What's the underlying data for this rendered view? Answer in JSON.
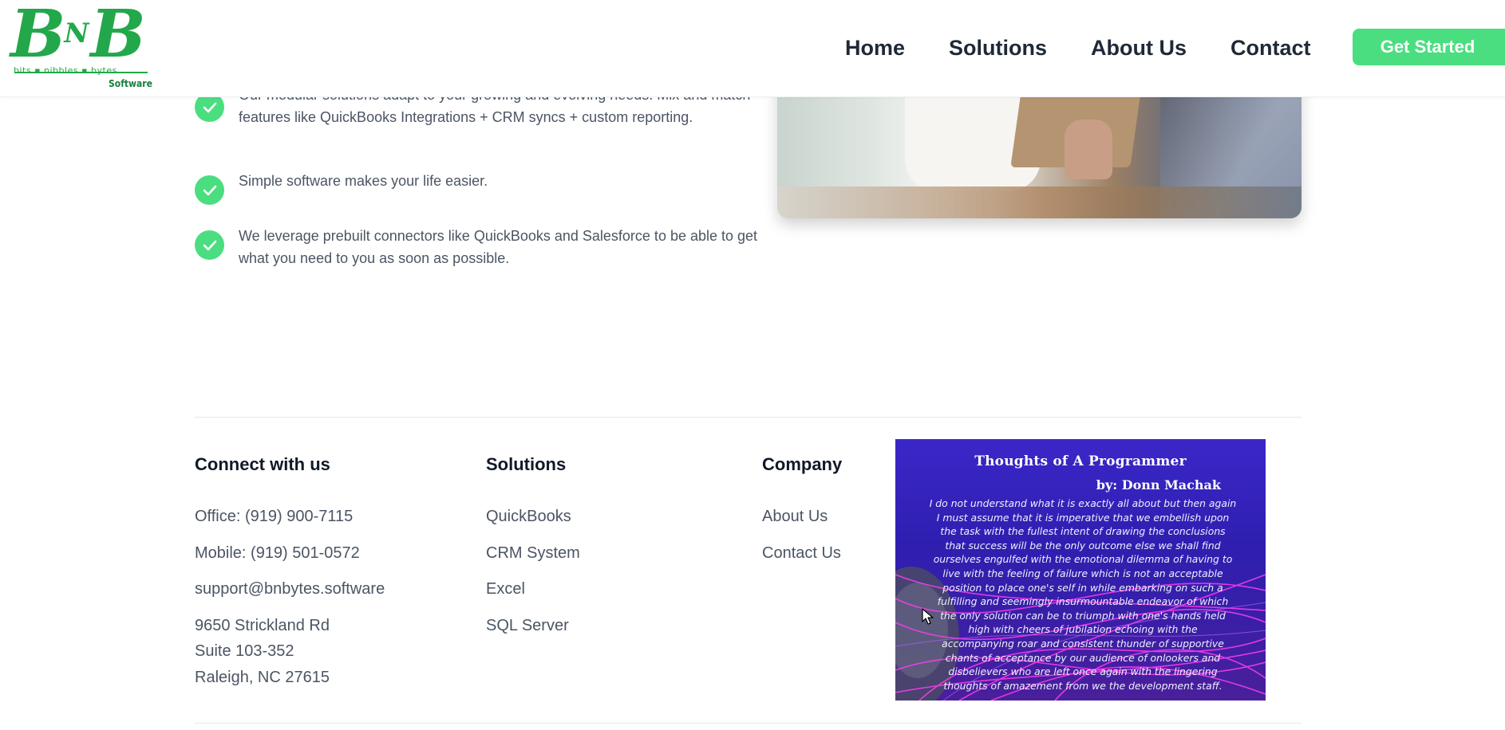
{
  "header": {
    "logo": {
      "mark_big": "B",
      "mark_small": "N",
      "mark_big2": "B",
      "tagline": "bits  ▪  nibbles  ▪  bytes",
      "sub": "Software"
    },
    "nav": [
      {
        "label": "Home"
      },
      {
        "label": "Solutions"
      },
      {
        "label": "About Us"
      },
      {
        "label": "Contact"
      }
    ],
    "cta_label": "Get Started"
  },
  "features": [
    {
      "text": "Our modular solutions adapt to your growing and evolving needs. Mix and match features like QuickBooks Integrations + CRM syncs + custom reporting."
    },
    {
      "text": "Simple software makes your life easier."
    },
    {
      "text": "We leverage prebuilt connectors like QuickBooks and Salesforce to be able to get what you need to you as soon as possible."
    }
  ],
  "footer": {
    "connect": {
      "title": "Connect with us",
      "office": "Office: (919) 900-7115",
      "mobile": "Mobile: (919) 501-0572",
      "email": "support@bnbytes.software",
      "address_line1": "9650 Strickland Rd",
      "address_line2": "Suite 103-352",
      "address_line3": "Raleigh, NC 27615"
    },
    "solutions": {
      "title": "Solutions",
      "items": [
        "QuickBooks",
        "CRM System",
        "Excel",
        "SQL Server"
      ]
    },
    "company": {
      "title": "Company",
      "items": [
        "About Us",
        "Contact Us"
      ]
    }
  },
  "poem": {
    "title": "Thoughts of A Programmer",
    "author": "by: Donn Machak",
    "lines": [
      "I do not understand what it is exactly all about but then again",
      "I must assume that it is imperative that we embellish upon",
      "the task with the fullest intent of drawing the conclusions",
      "that success will be the only outcome else we shall find",
      "ourselves engulfed with the emotional dilemma of having to",
      "live with the feeling of failure which is not an acceptable",
      "position to place one's self in while embarking on such a",
      "fulfilling and seemingly insurmountable endeavor of which",
      "the only solution can be to triumph with one's hands held",
      "high with cheers of jubilation echoing with the",
      "accompanying roar and consistent thunder of supportive",
      "chants of acceptance by our audience of onlookers and",
      "disbelievers who are left once again with the lingering",
      "thoughts of amazement from we the development staff."
    ]
  },
  "colors": {
    "brand_green": "#22a84a",
    "accent_green": "#4ade80",
    "poem_bg": "#3b27c8"
  }
}
